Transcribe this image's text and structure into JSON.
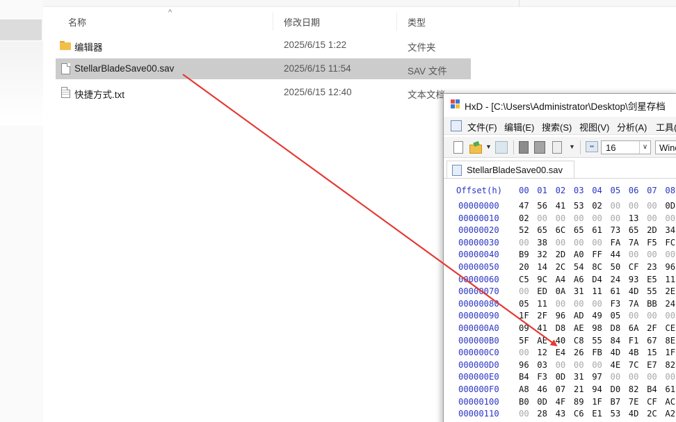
{
  "explorer": {
    "columns": {
      "name": "名称",
      "date": "修改日期",
      "type": "类型"
    },
    "files": [
      {
        "icon": "folder-icon",
        "name": "编辑器",
        "date": "2025/6/15 1:22",
        "type": "文件夹",
        "selected": false
      },
      {
        "icon": "file-icon",
        "name": "StellarBladeSave00.sav",
        "date": "2025/6/15 11:54",
        "type": "SAV 文件",
        "selected": true
      },
      {
        "icon": "text-file-icon",
        "name": "快捷方式.txt",
        "date": "2025/6/15 12:40",
        "type": "文本文档",
        "selected": false
      }
    ]
  },
  "hxd": {
    "title": "HxD - [C:\\Users\\Administrator\\Desktop\\剑星存档",
    "menu": [
      "文件(F)",
      "编辑(E)",
      "搜索(S)",
      "视图(V)",
      "分析(A)",
      "工具("
    ],
    "toolbar": {
      "bytes_per_row": "16",
      "charset": "Wind"
    },
    "tab": "StellarBladeSave00.sav",
    "offset_header": "Offset(h)",
    "columns": [
      "00",
      "01",
      "02",
      "03",
      "04",
      "05",
      "06",
      "07",
      "08"
    ],
    "rows": [
      {
        "addr": "00000000",
        "bytes": [
          "47",
          "56",
          "41",
          "53",
          "02",
          "00",
          "00",
          "00",
          "0D"
        ]
      },
      {
        "addr": "00000010",
        "bytes": [
          "02",
          "00",
          "00",
          "00",
          "00",
          "00",
          "13",
          "00",
          "00"
        ]
      },
      {
        "addr": "00000020",
        "bytes": [
          "52",
          "65",
          "6C",
          "65",
          "61",
          "73",
          "65",
          "2D",
          "34"
        ]
      },
      {
        "addr": "00000030",
        "bytes": [
          "00",
          "38",
          "00",
          "00",
          "00",
          "FA",
          "7A",
          "F5",
          "FC"
        ]
      },
      {
        "addr": "00000040",
        "bytes": [
          "B9",
          "32",
          "2D",
          "A0",
          "FF",
          "44",
          "00",
          "00",
          "00"
        ]
      },
      {
        "addr": "00000050",
        "bytes": [
          "20",
          "14",
          "2C",
          "54",
          "8C",
          "50",
          "CF",
          "23",
          "96"
        ]
      },
      {
        "addr": "00000060",
        "bytes": [
          "C5",
          "9C",
          "A4",
          "A6",
          "D4",
          "24",
          "93",
          "E5",
          "11"
        ]
      },
      {
        "addr": "00000070",
        "bytes": [
          "00",
          "ED",
          "0A",
          "31",
          "11",
          "61",
          "4D",
          "55",
          "2E"
        ]
      },
      {
        "addr": "00000080",
        "bytes": [
          "05",
          "11",
          "00",
          "00",
          "00",
          "F3",
          "7A",
          "BB",
          "24"
        ]
      },
      {
        "addr": "00000090",
        "bytes": [
          "1F",
          "2F",
          "96",
          "AD",
          "49",
          "05",
          "00",
          "00",
          "00"
        ]
      },
      {
        "addr": "000000A0",
        "bytes": [
          "09",
          "41",
          "D8",
          "AE",
          "98",
          "D8",
          "6A",
          "2F",
          "CE"
        ]
      },
      {
        "addr": "000000B0",
        "bytes": [
          "5F",
          "AE",
          "40",
          "C8",
          "55",
          "84",
          "F1",
          "67",
          "8E"
        ]
      },
      {
        "addr": "000000C0",
        "bytes": [
          "00",
          "12",
          "E4",
          "26",
          "FB",
          "4D",
          "4B",
          "15",
          "1F"
        ]
      },
      {
        "addr": "000000D0",
        "bytes": [
          "96",
          "03",
          "00",
          "00",
          "00",
          "4E",
          "7C",
          "E7",
          "82"
        ]
      },
      {
        "addr": "000000E0",
        "bytes": [
          "B4",
          "F3",
          "0D",
          "31",
          "97",
          "00",
          "00",
          "00",
          "00"
        ]
      },
      {
        "addr": "000000F0",
        "bytes": [
          "A8",
          "46",
          "07",
          "21",
          "94",
          "D0",
          "82",
          "B4",
          "61"
        ]
      },
      {
        "addr": "00000100",
        "bytes": [
          "B0",
          "0D",
          "4F",
          "89",
          "1F",
          "B7",
          "7E",
          "CF",
          "AC"
        ]
      },
      {
        "addr": "00000110",
        "bytes": [
          "00",
          "28",
          "43",
          "C6",
          "E1",
          "53",
          "4D",
          "2C",
          "A2"
        ]
      }
    ]
  },
  "colors": {
    "selection": "#cccccc",
    "hex_address": "#2a36c4",
    "annotation_arrow": "#e53935"
  }
}
